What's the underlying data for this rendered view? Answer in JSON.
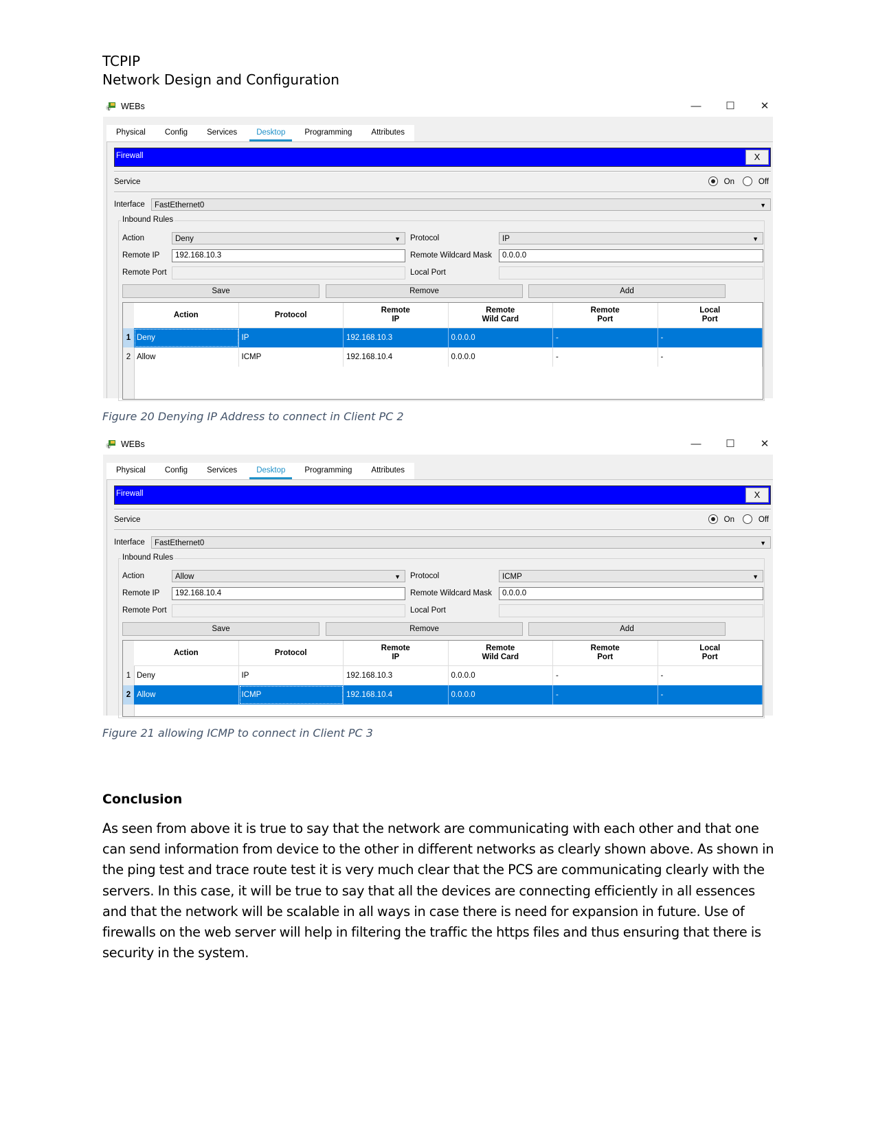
{
  "document": {
    "title_line1": "TCPIP",
    "title_line2": "Network Design and Configuration"
  },
  "figures": [
    {
      "caption": "Figure 20 Denying IP Address to connect in Client PC 2",
      "window": {
        "title": "WEBs",
        "app_icon": "packet-tracer-server-icon",
        "controls": {
          "minimize": "—",
          "maximize": "☐",
          "close": "✕"
        },
        "tabs": [
          {
            "label": "Physical",
            "active": false
          },
          {
            "label": "Config",
            "active": false
          },
          {
            "label": "Services",
            "active": false
          },
          {
            "label": "Desktop",
            "active": true
          },
          {
            "label": "Programming",
            "active": false
          },
          {
            "label": "Attributes",
            "active": false
          }
        ],
        "firewall_title": "Firewall",
        "close_label": "X",
        "service_label": "Service",
        "service_on_label": "On",
        "service_off_label": "Off",
        "service_state": "On",
        "interface_label": "Interface",
        "interface_value": "FastEthernet0",
        "inbound_rules_label": "Inbound Rules",
        "form": {
          "action_label": "Action",
          "action_value": "Deny",
          "protocol_label": "Protocol",
          "protocol_value": "IP",
          "remote_ip_label": "Remote IP",
          "remote_ip_value": "192.168.10.3",
          "remote_wildcard_label": "Remote Wildcard Mask",
          "remote_wildcard_value": "0.0.0.0",
          "remote_port_label": "Remote Port",
          "remote_port_value": "",
          "local_port_label": "Local Port",
          "local_port_value": ""
        },
        "buttons": {
          "save": "Save",
          "remove": "Remove",
          "add": "Add"
        },
        "table": {
          "headers": [
            "Action",
            "Protocol",
            "Remote\nIP",
            "Remote\nWild Card",
            "Remote\nPort",
            "Local\nPort"
          ],
          "rows": [
            {
              "num": "1",
              "cells": [
                "Deny",
                "IP",
                "192.168.10.3",
                "0.0.0.0",
                "-",
                "-"
              ],
              "selected": true
            },
            {
              "num": "2",
              "cells": [
                "Allow",
                "ICMP",
                "192.168.10.4",
                "0.0.0.0",
                "-",
                "-"
              ],
              "selected": false
            }
          ]
        }
      }
    },
    {
      "caption": "Figure 21 allowing ICMP to connect in Client PC 3",
      "window": {
        "title": "WEBs",
        "app_icon": "packet-tracer-server-icon",
        "controls": {
          "minimize": "—",
          "maximize": "☐",
          "close": "✕"
        },
        "tabs": [
          {
            "label": "Physical",
            "active": false
          },
          {
            "label": "Config",
            "active": false
          },
          {
            "label": "Services",
            "active": false
          },
          {
            "label": "Desktop",
            "active": true
          },
          {
            "label": "Programming",
            "active": false
          },
          {
            "label": "Attributes",
            "active": false
          }
        ],
        "firewall_title": "Firewall",
        "close_label": "X",
        "service_label": "Service",
        "service_on_label": "On",
        "service_off_label": "Off",
        "service_state": "On",
        "interface_label": "Interface",
        "interface_value": "FastEthernet0",
        "inbound_rules_label": "Inbound Rules",
        "form": {
          "action_label": "Action",
          "action_value": "Allow",
          "protocol_label": "Protocol",
          "protocol_value": "ICMP",
          "remote_ip_label": "Remote IP",
          "remote_ip_value": "192.168.10.4",
          "remote_wildcard_label": "Remote Wildcard Mask",
          "remote_wildcard_value": "0.0.0.0",
          "remote_port_label": "Remote Port",
          "remote_port_value": "",
          "local_port_label": "Local Port",
          "local_port_value": ""
        },
        "buttons": {
          "save": "Save",
          "remove": "Remove",
          "add": "Add"
        },
        "table": {
          "headers": [
            "Action",
            "Protocol",
            "Remote\nIP",
            "Remote\nWild Card",
            "Remote\nPort",
            "Local\nPort"
          ],
          "rows": [
            {
              "num": "1",
              "cells": [
                "Deny",
                "IP",
                "192.168.10.3",
                "0.0.0.0",
                "-",
                "-"
              ],
              "selected": false
            },
            {
              "num": "2",
              "cells": [
                "Allow",
                "ICMP",
                "192.168.10.4",
                "0.0.0.0",
                "-",
                "-"
              ],
              "selected": true
            }
          ]
        }
      }
    }
  ],
  "conclusion": {
    "heading": "Conclusion",
    "body": "As seen from above it is true to say that the network are communicating with each other and that one can send information from device to the other in different networks as clearly shown above. As shown in the ping test and trace route test it is very much clear that the PCS are communicating clearly with the servers. In this case, it will be true to say that all the devices are connecting efficiently in all essences and that the network will be scalable in all ways in case there is need for expansion in future. Use of firewalls on the web server will help in filtering the traffic the https files and thus ensuring that there is security in the system."
  },
  "colors": {
    "firewall_bar": "#0000ff",
    "selected_row": "#0078d7",
    "active_tab": "#1e90c8",
    "caption": "#44546a"
  }
}
